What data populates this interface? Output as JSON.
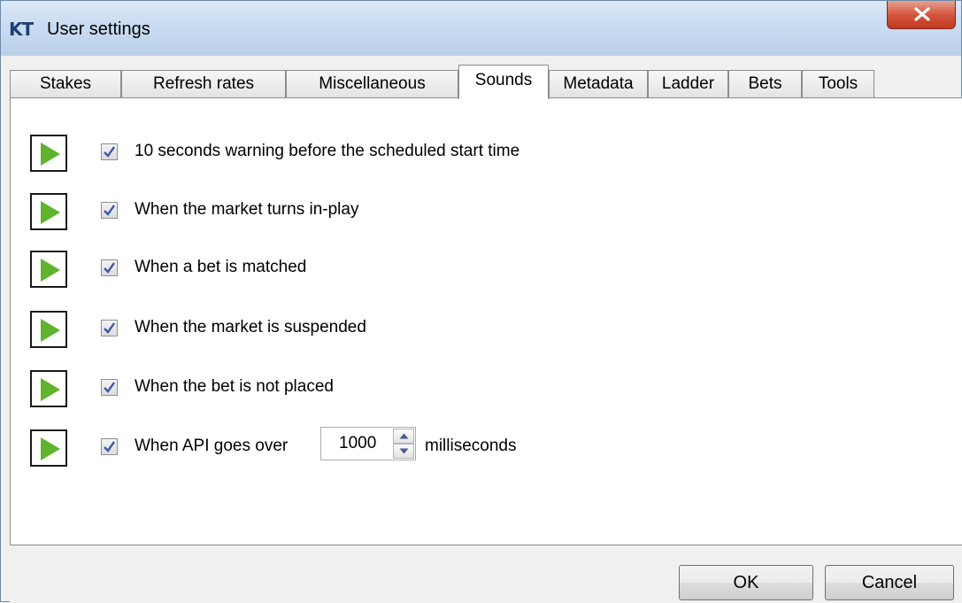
{
  "window": {
    "logo_text": "KT",
    "title": "User settings"
  },
  "tabs": [
    {
      "label": "Stakes",
      "active": false
    },
    {
      "label": "Refresh rates",
      "active": false
    },
    {
      "label": "Miscellaneous",
      "active": false
    },
    {
      "label": "Sounds",
      "active": true
    },
    {
      "label": "Metadata",
      "active": false
    },
    {
      "label": "Ladder",
      "active": false
    },
    {
      "label": "Bets",
      "active": false
    },
    {
      "label": "Tools",
      "active": false
    }
  ],
  "sounds": [
    {
      "label": "10 seconds warning before the scheduled start time",
      "checked": true
    },
    {
      "label": "When the market turns in-play",
      "checked": true
    },
    {
      "label": "When a bet is matched",
      "checked": true
    },
    {
      "label": "When the market is suspended",
      "checked": true
    },
    {
      "label": "When the bet is not placed",
      "checked": true
    },
    {
      "label": "When API goes over",
      "checked": true,
      "value": "1000",
      "suffix": "milliseconds"
    }
  ],
  "buttons": {
    "ok": "OK",
    "cancel": "Cancel"
  },
  "colors": {
    "play_green": "#5fb32e",
    "check_blue": "#3a59a8"
  }
}
